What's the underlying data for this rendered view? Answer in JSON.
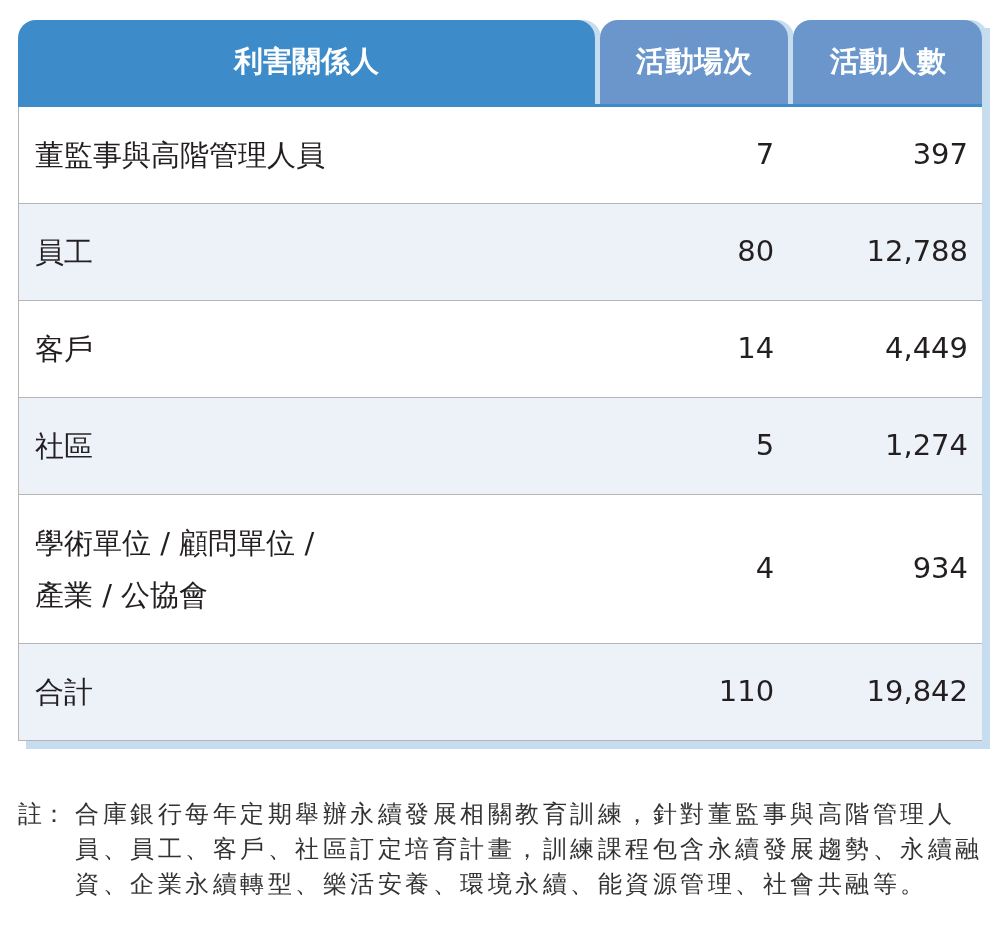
{
  "table": {
    "columns": [
      {
        "label": "利害關係人",
        "kind": "primary"
      },
      {
        "label": "活動場次",
        "kind": "secondary"
      },
      {
        "label": "活動人數",
        "kind": "secondary"
      }
    ],
    "rows": [
      {
        "stakeholder": "董監事與高階管理人員",
        "sessions": "7",
        "participants": "397"
      },
      {
        "stakeholder": "員工",
        "sessions": "80",
        "participants": "12,788"
      },
      {
        "stakeholder": "客戶",
        "sessions": "14",
        "participants": "4,449"
      },
      {
        "stakeholder": "社區",
        "sessions": "5",
        "participants": "1,274"
      },
      {
        "stakeholder": "學術單位 / 顧問單位 /\n產業 / 公協會",
        "sessions": "4",
        "participants": "934"
      },
      {
        "stakeholder": "合計",
        "sessions": "110",
        "participants": "19,842"
      }
    ]
  },
  "note": {
    "label": "註：",
    "text": "合庫銀行每年定期舉辦永續發展相關教育訓練，針對董監事與高階管理人員、員工、客戶、社區訂定培育計畫，訓練課程包含永續發展趨勢、永續融資、企業永續轉型、樂活安養、環境永續、能資源管理、社會共融等。"
  }
}
